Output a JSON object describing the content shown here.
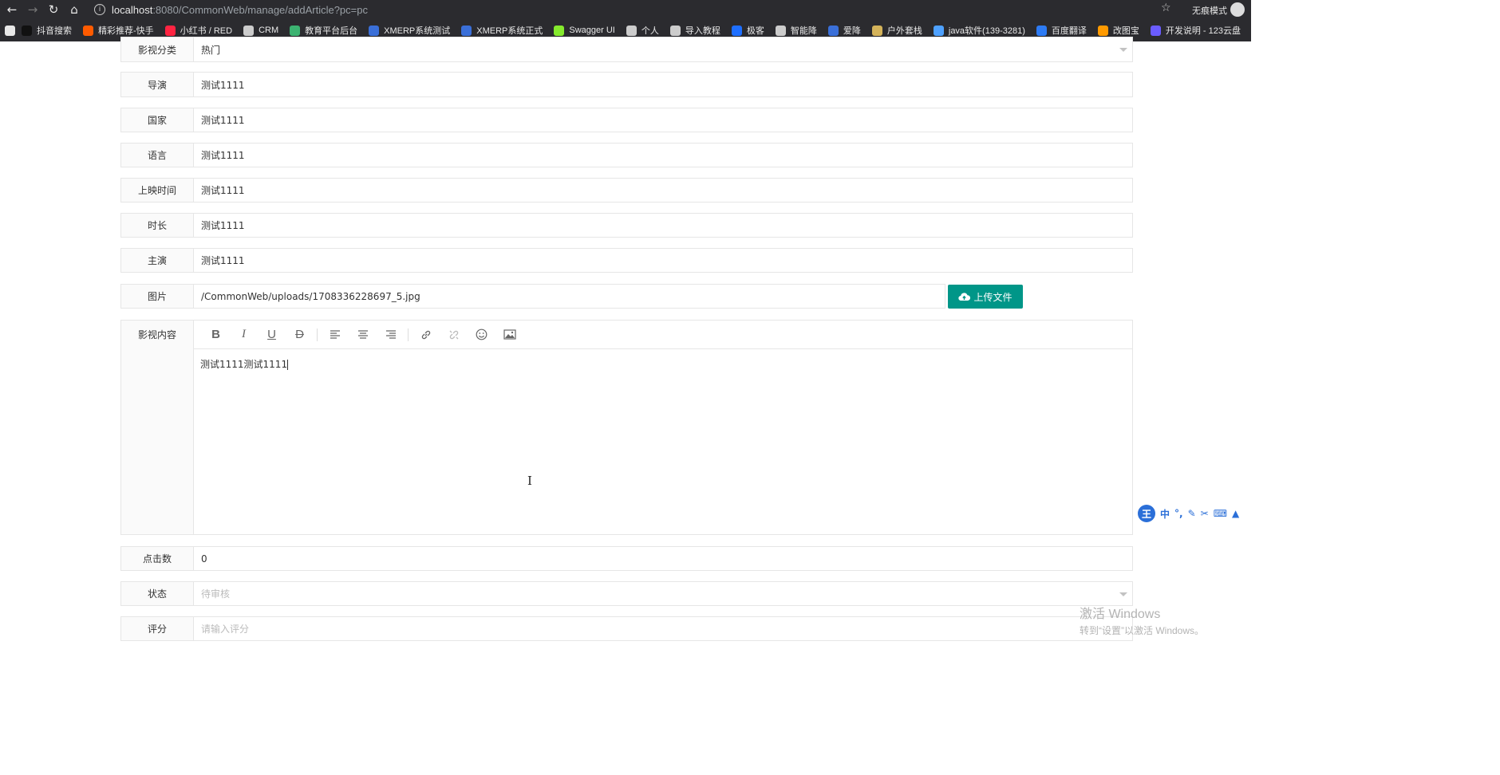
{
  "browser": {
    "url_host": "localhost",
    "url_rest": ":8080/CommonWeb/manage/addArticle?pc=pc",
    "incognito_label": "无痕模式",
    "bookmarks": [
      {
        "label": "抖音搜索",
        "color": "#111111"
      },
      {
        "label": "精彩推荐-快手",
        "color": "#ff5b00"
      },
      {
        "label": "小红书 / RED",
        "color": "#ff2442"
      },
      {
        "label": "CRM",
        "color": "#cccccc"
      },
      {
        "label": "教育平台后台",
        "color": "#3cb371"
      },
      {
        "label": "XMERP系统测试",
        "color": "#3a6fd8"
      },
      {
        "label": "XMERP系统正式",
        "color": "#3a6fd8"
      },
      {
        "label": "Swagger UI",
        "color": "#85ea2d"
      },
      {
        "label": "个人",
        "color": "#cccccc"
      },
      {
        "label": "导入教程",
        "color": "#cccccc"
      },
      {
        "label": "极客",
        "color": "#1e6fff"
      },
      {
        "label": "智能降",
        "color": "#cccccc"
      },
      {
        "label": "爱降",
        "color": "#3a6fd8"
      },
      {
        "label": "户外套栈",
        "color": "#d4b35a"
      },
      {
        "label": "java软件(139-3281)",
        "color": "#4ea1ff"
      },
      {
        "label": "百度翻译",
        "color": "#2d7bf4"
      },
      {
        "label": "改图宝",
        "color": "#ff9a00"
      },
      {
        "label": "开发说明 - 123云盘",
        "color": "#6a5cff"
      }
    ]
  },
  "form": {
    "category": {
      "label": "影视分类",
      "value": "热门"
    },
    "director": {
      "label": "导演",
      "value": "测试1111"
    },
    "country": {
      "label": "国家",
      "value": "测试1111"
    },
    "language": {
      "label": "语言",
      "value": "测试1111"
    },
    "release_time": {
      "label": "上映时间",
      "value": "测试1111"
    },
    "duration": {
      "label": "时长",
      "value": "测试1111"
    },
    "actors": {
      "label": "主演",
      "value": "测试1111"
    },
    "image": {
      "label": "图片",
      "value": "/CommonWeb/uploads/1708336228697_5.jpg",
      "upload_label": "上传文件"
    },
    "content": {
      "label": "影视内容",
      "value": "测试1111测试1111"
    },
    "clicks": {
      "label": "点击数",
      "value": "0"
    },
    "status": {
      "label": "状态",
      "placeholder": "待审核"
    },
    "rating": {
      "label": "评分",
      "placeholder": "请输入评分"
    }
  },
  "editor_toolbar": [
    "bold-icon",
    "italic-icon",
    "underline-icon",
    "strikethrough-icon",
    "align-left-icon",
    "align-center-icon",
    "align-right-icon",
    "link-icon",
    "unlink-icon",
    "emoji-icon",
    "image-icon"
  ],
  "ime": {
    "logo": "王",
    "mode": "中"
  },
  "watermark": {
    "line1": "激活 Windows",
    "line2": "转到“设置”以激活 Windows。"
  },
  "colors": {
    "accent": "#009688",
    "border": "#e6e6e6",
    "label_bg": "#fafafa"
  }
}
